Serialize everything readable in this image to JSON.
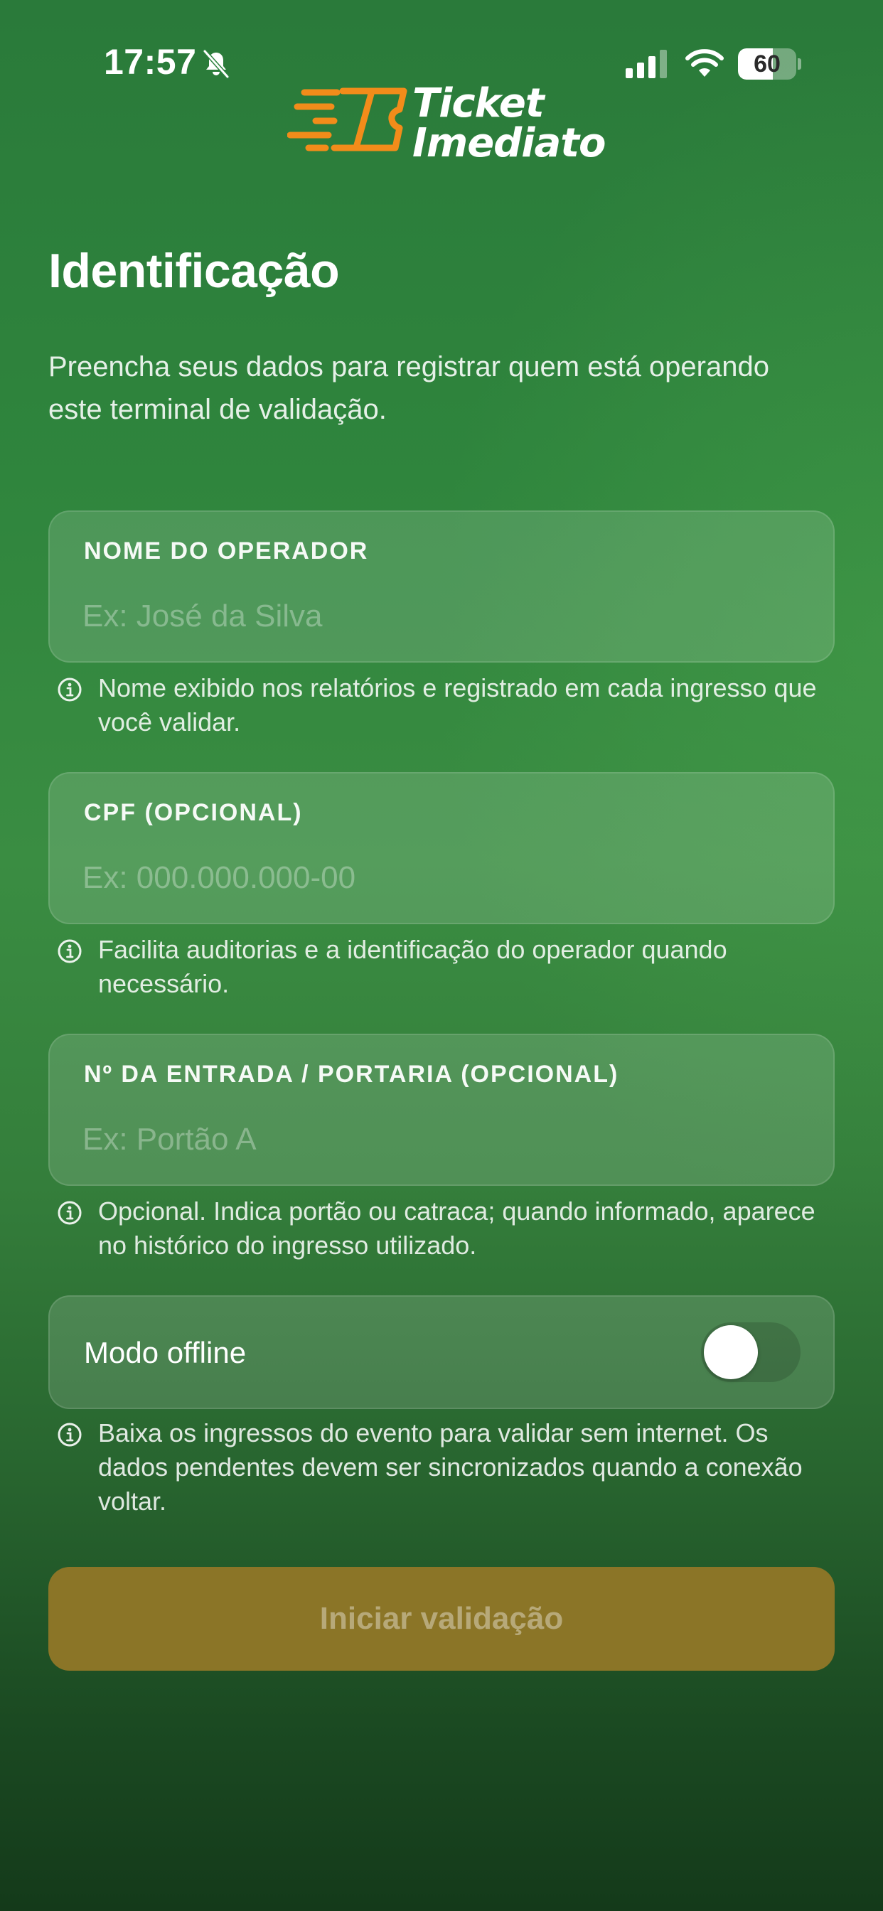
{
  "status_bar": {
    "time": "17:57",
    "battery_level": "60",
    "battery_fraction": 0.6
  },
  "logo": {
    "line1": "Ticket",
    "line2": "Imediato",
    "accent_color": "#f28c1a"
  },
  "page": {
    "title": "Identificação",
    "intro": "Preencha seus dados para registrar quem está operando este terminal de validação."
  },
  "fields": [
    {
      "label": "NOME DO OPERADOR",
      "placeholder": "Ex: José da Silva",
      "value": "",
      "hint": "Nome exibido nos relatórios e registrado em cada ingresso que você validar."
    },
    {
      "label": "CPF (OPCIONAL)",
      "placeholder": "Ex: 000.000.000-00",
      "value": "",
      "hint": "Facilita auditorias e a identificação do operador quando necessário."
    },
    {
      "label": "Nº DA ENTRADA / PORTARIA (OPCIONAL)",
      "placeholder": "Ex: Portão A",
      "value": "",
      "hint": "Opcional. Indica portão ou catraca; quando informado, aparece no histórico do ingresso utilizado."
    }
  ],
  "offline": {
    "label": "Modo offline",
    "enabled": false,
    "hint": "Baixa os ingressos do evento para validar sem internet. Os dados pendentes devem ser sincronizados quando a conexão voltar."
  },
  "submit": {
    "label": "Iniciar validação",
    "disabled": true,
    "color": "#8b7527"
  },
  "icons": {
    "status_mute": "bell-slash-icon",
    "signal": "cellular-signal-icon",
    "wifi": "wifi-icon",
    "hint": "info-circle-icon",
    "logo": "ticket-speed-icon"
  }
}
